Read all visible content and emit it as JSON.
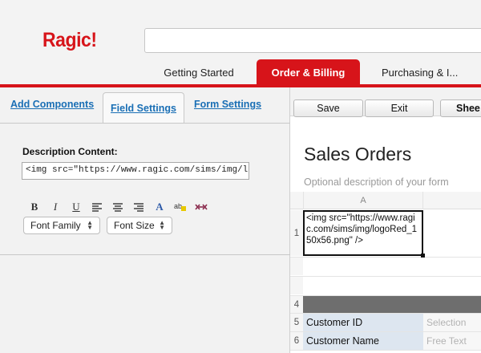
{
  "app": {
    "logo": "Ragic!"
  },
  "search": {
    "value": ""
  },
  "top_tabs": [
    {
      "label": "Getting Started"
    },
    {
      "label": "Order & Billing",
      "active": true
    },
    {
      "label": "Purchasing & I..."
    }
  ],
  "panel_tabs": [
    {
      "label": "Add Components"
    },
    {
      "label": "Field Settings",
      "active": true
    },
    {
      "label": "Form Settings"
    }
  ],
  "field_settings": {
    "description_label": "Description Content:",
    "description_value": "<img src=\"https://www.ragic.com/sims/img/logoRe"
  },
  "format_toolbar": {
    "bold": "B",
    "italic": "I",
    "underline": "U",
    "align_left": "≡",
    "align_center": "≡",
    "align_right": "≡",
    "font_color": "A",
    "font_family": "Font Family",
    "font_size": "Font Size"
  },
  "toolbar": {
    "save": "Save",
    "exit": "Exit",
    "sheet": "Shee"
  },
  "form": {
    "title": "Sales Orders",
    "description_placeholder": "Optional description of your form"
  },
  "grid": {
    "column_header": "A",
    "row_numbers": [
      "1",
      "4",
      "5",
      "6"
    ],
    "editing_cell_text": "<img src=\"https://www.ragic.com/sims/img/logoRed_150x56.png\" />",
    "fields": [
      {
        "label": "Customer ID",
        "type": "Selection"
      },
      {
        "label": "Customer Name",
        "type": "Free Text"
      }
    ]
  },
  "colors": {
    "brand_red": "#d7141a",
    "link_blue": "#1a6fb5",
    "field_label_bg": "#dde6f0"
  }
}
